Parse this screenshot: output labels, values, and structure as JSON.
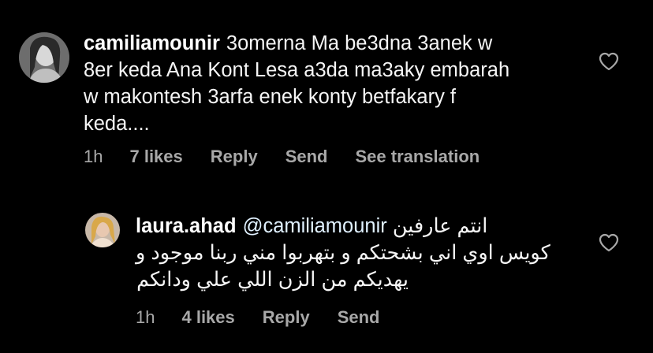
{
  "comments": [
    {
      "username": "camiliamounir",
      "text_lines": [
        "3omerna Ma be3dna 3anek w",
        "8er keda Ana Kont Lesa a3da ma3aky embarah",
        "w makontesh 3arfa enek konty betfakary f",
        "keda...."
      ],
      "time": "1h",
      "likes": "7 likes",
      "reply": "Reply",
      "send": "Send",
      "translate": "See translation",
      "like_icon": "heart-outline-icon"
    },
    {
      "username": "laura.ahad",
      "mention": "@camiliamounir",
      "first_line_text": "انتم عارفين",
      "text_lines": [
        "كويس اوي اني بشحتكم و بتهربوا مني ربنا موجود و",
        "يهديكم من الزن اللي علي ودانكم"
      ],
      "time": "1h",
      "likes": "4 likes",
      "reply": "Reply",
      "send": "Send",
      "like_icon": "heart-outline-icon"
    }
  ],
  "colors": {
    "background": "#000000",
    "text": "#f5f5f5",
    "secondary": "#a8a8a8"
  }
}
